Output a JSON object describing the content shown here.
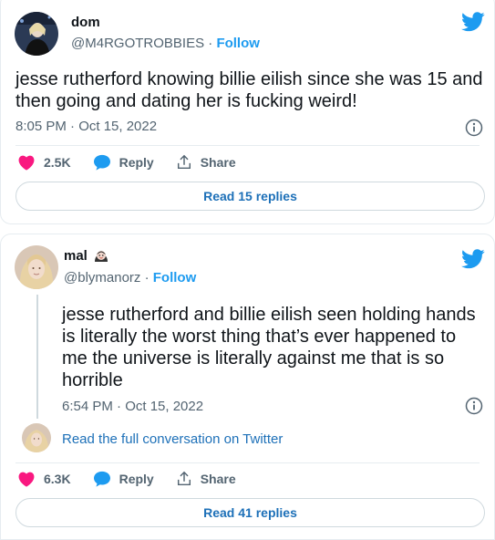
{
  "tweets": [
    {
      "display_name": "dom",
      "handle": "@M4RGOTROBBIES",
      "separator": "·",
      "follow_label": "Follow",
      "text_lines": [
        "jesse rutherford knowing billie eilish since she was 15 and",
        "then going and dating her is fucking weird!"
      ],
      "timestamp": "8:05 PM · Oct 15, 2022",
      "likes": "2.5K",
      "reply_label": "Reply",
      "share_label": "Share",
      "replies_label": "Read 15 replies"
    },
    {
      "display_name": "mal",
      "name_emoji": "vampire-emoji",
      "handle": "@blymanorz",
      "separator": "·",
      "follow_label": "Follow",
      "text_lines": [
        "jesse rutherford and billie eilish seen holding hands",
        "is literally the worst thing that’s ever happened to",
        "me the universe is literally against me that is so",
        "horrible"
      ],
      "timestamp": "6:54 PM · Oct 15, 2022",
      "conversation_link": "Read the full conversation on Twitter",
      "likes": "6.3K",
      "reply_label": "Reply",
      "share_label": "Share",
      "replies_label": "Read 41 replies"
    }
  ],
  "colors": {
    "like": "#f91880",
    "reply": "#1d9bf0",
    "link": "#1d70b8",
    "twitter_bird": "#1d9bf0",
    "muted": "#536471"
  },
  "icons": [
    "twitter-bird-icon",
    "info-icon",
    "heart-icon",
    "reply-bubble-icon",
    "share-icon"
  ]
}
